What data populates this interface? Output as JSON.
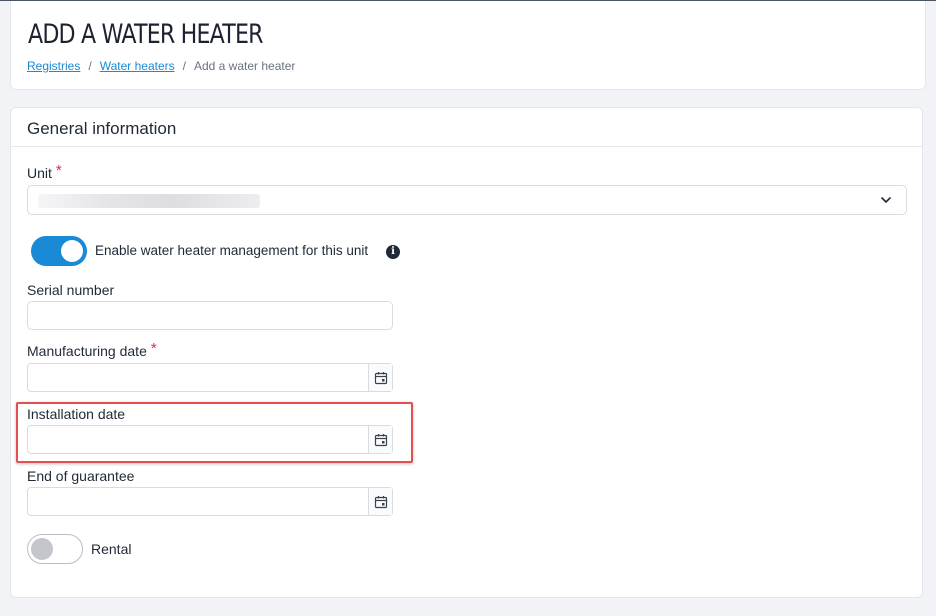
{
  "header": {
    "title": "ADD A WATER HEATER",
    "breadcrumb": {
      "items": [
        "Registries",
        "Water heaters"
      ],
      "separator": "/",
      "current": "Add a water heater"
    }
  },
  "form": {
    "section_title": "General information",
    "unit": {
      "label": "Unit",
      "required_mark": "*",
      "value": ""
    },
    "management_toggle": {
      "label": "Enable water heater management for this unit",
      "state": "on",
      "info_icon": "i"
    },
    "serial_number": {
      "label": "Serial number",
      "value": ""
    },
    "manufacturing_date": {
      "label": "Manufacturing date",
      "required_mark": "*",
      "value": ""
    },
    "installation_date": {
      "label": "Installation date",
      "value": ""
    },
    "end_of_guarantee": {
      "label": "End of guarantee",
      "value": ""
    },
    "rental_toggle": {
      "label": "Rental",
      "state": "off"
    }
  },
  "colors": {
    "accent": "#1a8ad6",
    "required": "#e0245e",
    "highlight": "#e25050"
  }
}
